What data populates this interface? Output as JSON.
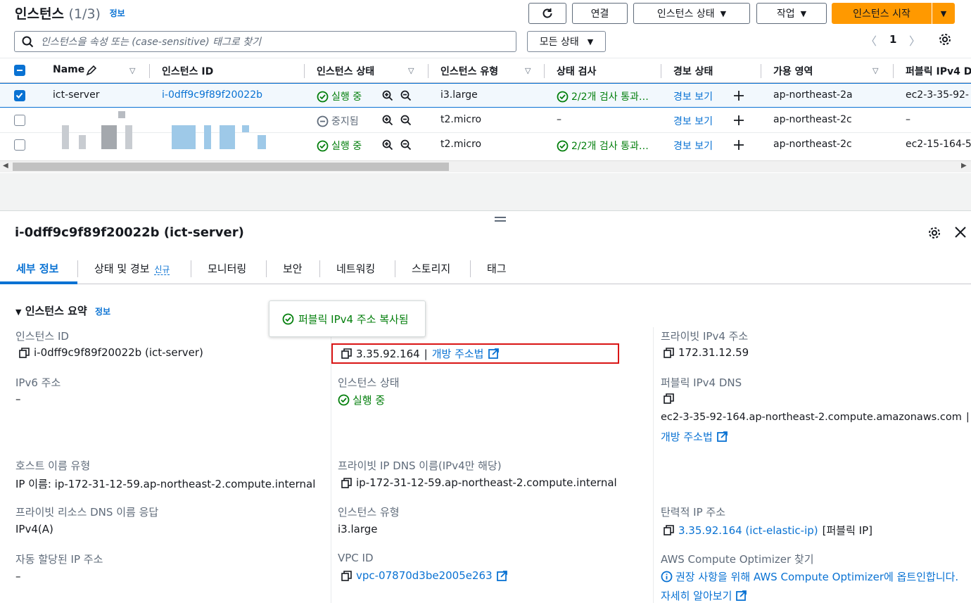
{
  "header": {
    "title": "인스턴스",
    "count": "(1/3)",
    "info_label": "정보",
    "buttons": {
      "connect": "연결",
      "instance_state": "인스턴스 상태",
      "actions": "작업",
      "launch": "인스턴스 시작"
    }
  },
  "search": {
    "placeholder": "인스턴스을 속성 또는 (case-sensitive) 태그로 찾기"
  },
  "filter": {
    "state_select": "모든 상태"
  },
  "pager": {
    "page": "1"
  },
  "table": {
    "columns": [
      "Name",
      "인스턴스 ID",
      "인스턴스 상태",
      "인스턴스 유형",
      "상태 검사",
      "경보 상태",
      "가용 영역",
      "퍼블릭 IPv4 D"
    ],
    "rows": [
      {
        "name": "ict-server",
        "instance_id": "i-0dff9c9f89f20022b",
        "state": "실행 중",
        "type": "i3.large",
        "check": "2/2개 검사 통과…",
        "alarm": "경보 보기",
        "az": "ap-northeast-2a",
        "dns": "ec2-3-35-92-"
      },
      {
        "name": "",
        "instance_id": "",
        "state": "중지됨",
        "type": "t2.micro",
        "check": "–",
        "alarm": "경보 보기",
        "az": "ap-northeast-2c",
        "dns": "–"
      },
      {
        "name": "",
        "instance_id": "",
        "state": "실행 중",
        "type": "t2.micro",
        "check": "2/2개 검사 통과…",
        "alarm": "경보 보기",
        "az": "ap-northeast-2c",
        "dns": "ec2-15-164-5"
      }
    ]
  },
  "detail": {
    "title": "i-0dff9c9f89f20022b (ict-server)",
    "tabs": [
      "세부 정보",
      "상태 및 경보",
      "모니터링",
      "보안",
      "네트워킹",
      "스토리지",
      "태그"
    ],
    "new_badge": "신규",
    "section_title": "인스턴스 요약",
    "section_info": "정보",
    "tooltip": "퍼블릭 IPv4 주소 복사됨",
    "fields": {
      "instance_id_label": "인스턴스 ID",
      "instance_id_value": "i-0dff9c9f89f20022b (ict-server)",
      "public_ip_value": "3.35.92.164",
      "open_address": "개방 주소법",
      "private_ip_label": "프라이빗 IPv4 주소",
      "private_ip_value": "172.31.12.59",
      "ipv6_label": "IPv6 주소",
      "ipv6_value": "–",
      "instance_state_label": "인스턴스 상태",
      "instance_state_value": "실행 중",
      "public_dns_label": "퍼블릭 IPv4 DNS",
      "public_dns_value": "ec2-3-35-92-164.ap-northeast-2.compute.amazonaws.com",
      "public_dns_open": "개방 주소법",
      "host_type_label": "호스트 이름 유형",
      "host_type_value": "IP 이름: ip-172-31-12-59.ap-northeast-2.compute.internal",
      "private_dns_label": "프라이빗 IP DNS 이름(IPv4만 해당)",
      "private_dns_value": "ip-172-31-12-59.ap-northeast-2.compute.internal",
      "private_resource_label": "프라이빗 리소스 DNS 이름 응답",
      "private_resource_value": "IPv4(A)",
      "instance_type_label": "인스턴스 유형",
      "instance_type_value": "i3.large",
      "elastic_ip_label": "탄력적 IP 주소",
      "elastic_ip_value": "3.35.92.164 (ict-elastic-ip)",
      "elastic_ip_suffix": "[퍼블릭 IP]",
      "auto_ip_label": "자동 할당된 IP 주소",
      "auto_ip_value": "–",
      "vpc_label": "VPC ID",
      "vpc_value": "vpc-07870d3be2005e263",
      "optimizer_label": "AWS Compute Optimizer 찾기",
      "optimizer_value": "권장 사항을 위해 AWS Compute Optimizer에 옵트인합니다.",
      "learn_more": "자세히 알아보기"
    }
  },
  "colors": {
    "primary": "#ff9900",
    "link": "#0972d3",
    "success": "#037f0c",
    "error_outline": "#d91515"
  }
}
